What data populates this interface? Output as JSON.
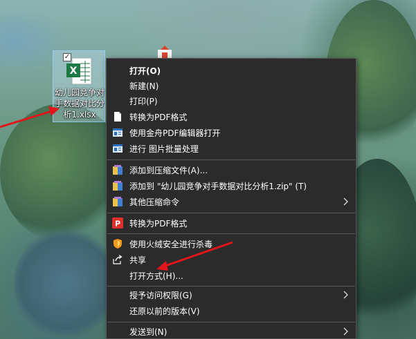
{
  "desktop": {
    "file": {
      "name": "幼儿园竞争对手数据对比分析1.xlsx",
      "icon": "excel-file-icon",
      "selected": true
    }
  },
  "context_menu": {
    "items": [
      {
        "label": "打开(O)",
        "bold": true
      },
      {
        "label": "新建(N)"
      },
      {
        "label": "打印(P)"
      },
      {
        "label": "转换为PDF格式",
        "icon": "document-icon"
      },
      {
        "label": "使用金舟PDF编辑器打开",
        "icon": "pdf-editor-icon"
      },
      {
        "label": "进行 图片批量处理",
        "icon": "image-batch-icon"
      },
      {
        "label": "添加到压缩文件(A)...",
        "icon": "archive-icon"
      },
      {
        "label": "添加到 \"幼儿园竞争对手数据对比分析1.zip\" (T)",
        "icon": "archive-icon"
      },
      {
        "label": "其他压缩命令",
        "icon": "archive-icon",
        "submenu": true
      },
      {
        "label": "转换为PDF格式",
        "icon": "pdf-convert-icon"
      },
      {
        "label": "使用火绒安全进行杀毒",
        "icon": "shield-icon"
      },
      {
        "label": "共享",
        "icon": "share-icon"
      },
      {
        "label": "打开方式(H)..."
      },
      {
        "label": "授予访问权限(G)",
        "submenu": true
      },
      {
        "label": "还原以前的版本(V)"
      },
      {
        "label": "发送到(N)",
        "submenu": true
      }
    ]
  },
  "colors": {
    "menu_bg": "#2b2b2b",
    "menu_text": "#ffffff",
    "separator": "#5a5a5a",
    "annotation_arrow": "#e0161a",
    "excel_green": "#1d7a45"
  }
}
